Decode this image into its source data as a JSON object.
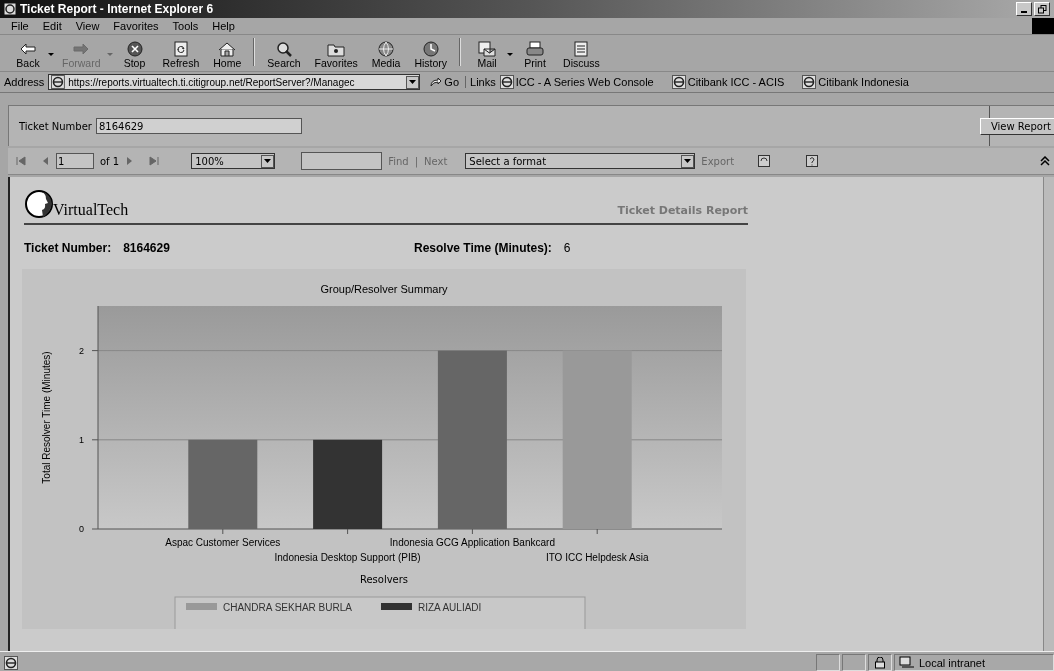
{
  "window": {
    "title": "Ticket Report - Internet Explorer 6"
  },
  "menu": [
    "File",
    "Edit",
    "View",
    "Favorites",
    "Tools",
    "Help"
  ],
  "toolbar": [
    {
      "kind": "back",
      "label": "Back",
      "disabled": false,
      "dropdown": true
    },
    {
      "kind": "forward",
      "label": "Forward",
      "disabled": true,
      "dropdown": true
    },
    {
      "kind": "stop",
      "label": "Stop",
      "disabled": false,
      "dropdown": false
    },
    {
      "kind": "refresh",
      "label": "Refresh",
      "disabled": false,
      "dropdown": false
    },
    {
      "kind": "home",
      "label": "Home",
      "disabled": false,
      "dropdown": false
    },
    {
      "kind": "search",
      "label": "Search",
      "disabled": false,
      "dropdown": false
    },
    {
      "kind": "favorites",
      "label": "Favorites",
      "disabled": false,
      "dropdown": false
    },
    {
      "kind": "media",
      "label": "Media",
      "disabled": false,
      "dropdown": false
    },
    {
      "kind": "history",
      "label": "History",
      "disabled": false,
      "dropdown": false
    },
    {
      "kind": "mail",
      "label": "Mail",
      "disabled": false,
      "dropdown": true
    },
    {
      "kind": "print",
      "label": "Print",
      "disabled": false,
      "dropdown": false
    },
    {
      "kind": "discuss",
      "label": "Discuss",
      "disabled": false,
      "dropdown": false
    }
  ],
  "address": {
    "label": "Address",
    "value": "https://reports.virtualtech.ti.citigroup.net/ReportServer?/Managec",
    "go": "Go"
  },
  "links": {
    "label": "Links",
    "items": [
      "ICC - A Series Web Console",
      "Citibank ICC - ACIS",
      "Citibank Indonesia"
    ]
  },
  "parameters": {
    "label": "Ticket Number",
    "value": "8164629",
    "button": "View Report"
  },
  "report_toolbar": {
    "page": "1",
    "of": "of 1",
    "zoom": "100%",
    "find": "Find",
    "separator": "|",
    "next": "Next",
    "format": "Select a format",
    "export": "Export"
  },
  "report": {
    "company": "VirtualTech",
    "title": "Ticket Details Report",
    "fields": [
      {
        "label": "Ticket Number:",
        "value": "8164629"
      },
      {
        "label": "Resolve Time (Minutes):",
        "value": "6"
      }
    ],
    "chart_data": {
      "type": "bar",
      "title": "Group/Resolver Summary",
      "xlabel": "Resolvers",
      "ylabel": "Total Resolver Time (Minutes)",
      "stacked": true,
      "categories": [
        "Aspac Customer Services",
        "Indonesia Desktop Support (PIB)",
        "Indonesia GCG Application Bankcard",
        "ITO ICC Helpdesk Asia"
      ],
      "legend": "bottom",
      "ylim": [
        0,
        2.5
      ],
      "yticks": [
        0,
        1,
        2
      ],
      "series": [
        {
          "name": "CHANDRA SEKHAR BURLA",
          "color": "#999999",
          "values": [
            null,
            null,
            null,
            2
          ]
        },
        {
          "name": "RIZA AULIADI",
          "color": "#333333",
          "values": [
            null,
            1,
            null,
            null
          ]
        },
        {
          "color": "#666666",
          "values": [
            1,
            null,
            2,
            null
          ]
        }
      ]
    }
  },
  "status_bar": {
    "zone": "Local intranet"
  }
}
